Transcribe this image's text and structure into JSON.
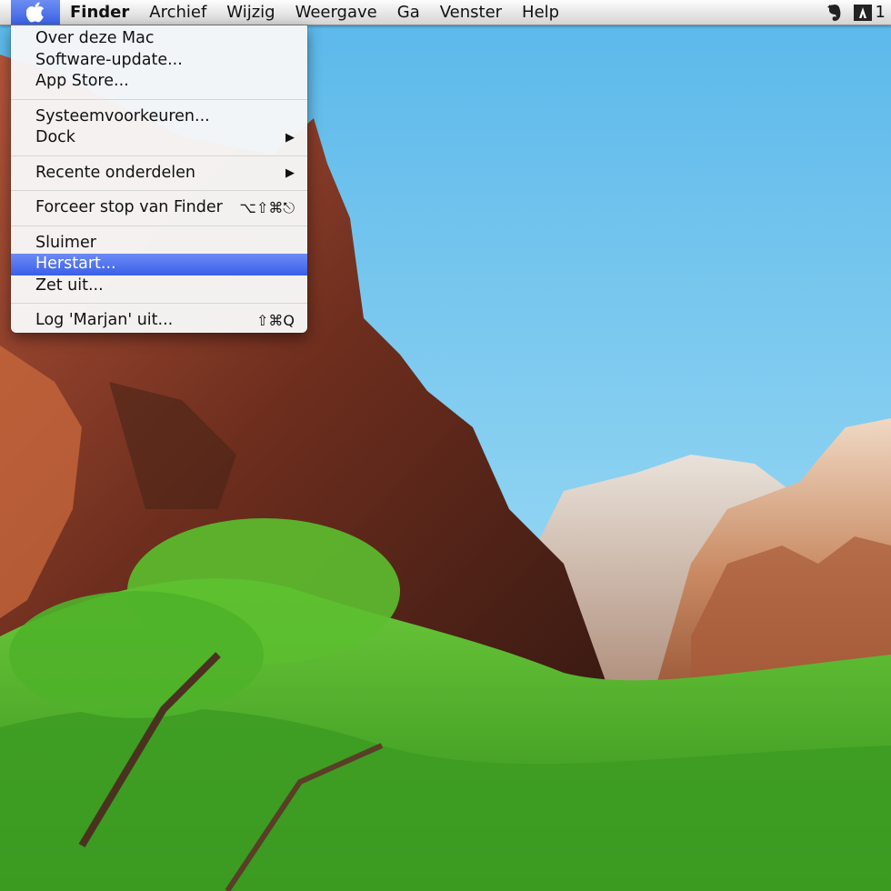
{
  "menubar": {
    "apple_icon": "apple-logo-icon",
    "app_name": "Finder",
    "menus": [
      "Archief",
      "Wijzig",
      "Weergave",
      "Ga",
      "Venster",
      "Help"
    ],
    "status": {
      "evernote_icon": "evernote-icon",
      "adobe_icon": "adobe-icon",
      "adobe_text": "1"
    }
  },
  "apple_menu": {
    "items": [
      {
        "label": "Over deze Mac"
      },
      {
        "label": "Software-update..."
      },
      {
        "label": "App Store..."
      },
      {
        "label": "Systeemvoorkeuren..."
      },
      {
        "label": "Dock",
        "submenu": "▶"
      },
      {
        "label": "Recente onderdelen",
        "submenu": "▶"
      },
      {
        "label": "Forceer stop van Finder",
        "shortcut": "⌥⇧⌘⎋"
      },
      {
        "label": "Sluimer"
      },
      {
        "label": "Herstart..."
      },
      {
        "label": "Zet uit..."
      },
      {
        "label": "Log 'Marjan' uit...",
        "shortcut": "⇧⌘Q"
      }
    ],
    "selected_label": "Herstart..."
  },
  "colors": {
    "sky": "#6fc4ec",
    "highlight": "#3a5fe8",
    "rock": "#8a3a22",
    "foliage": "#4caf2a"
  }
}
